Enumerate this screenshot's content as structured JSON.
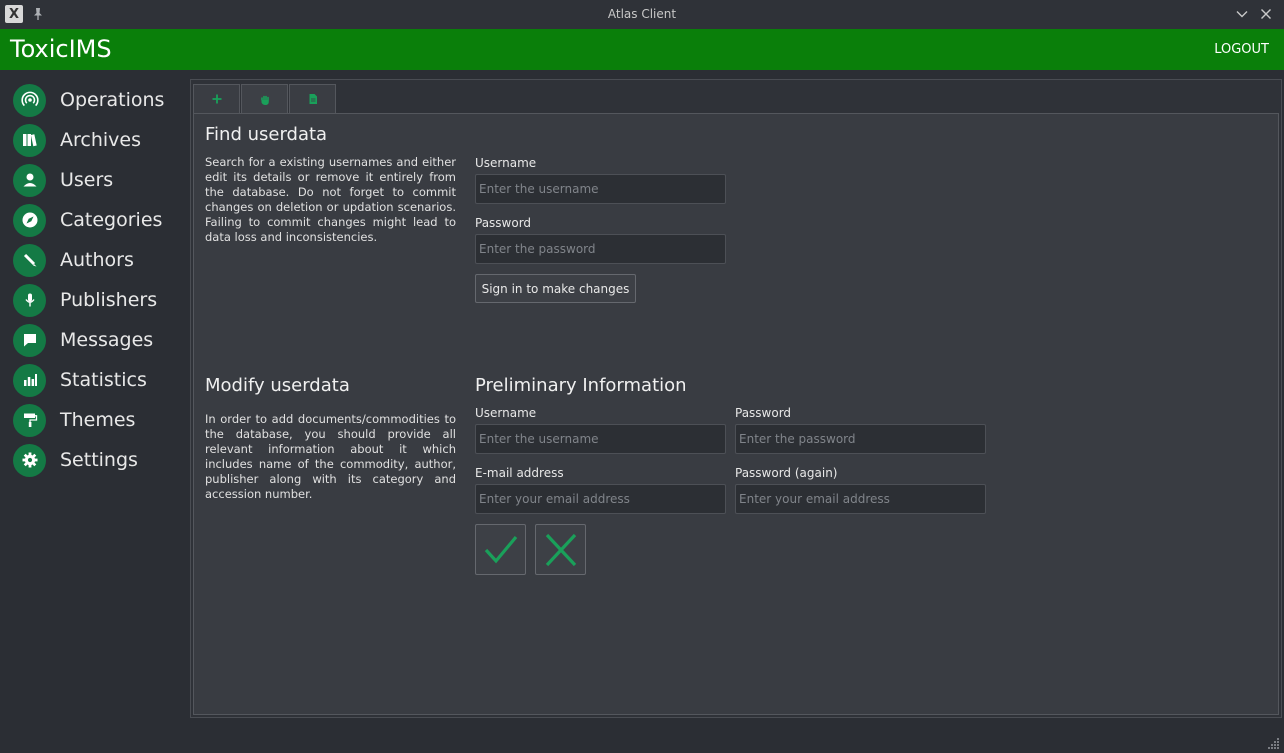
{
  "window": {
    "title": "Atlas Client",
    "app_icon_glyph": "X"
  },
  "header": {
    "brand": "ToxicIMS",
    "logout_label": "LOGOUT",
    "accent_color": "#0a7f0a"
  },
  "sidebar": {
    "items": [
      {
        "label": "Operations",
        "icon": "broadcast-icon"
      },
      {
        "label": "Archives",
        "icon": "books-icon"
      },
      {
        "label": "Users",
        "icon": "user-icon"
      },
      {
        "label": "Categories",
        "icon": "compass-icon"
      },
      {
        "label": "Authors",
        "icon": "pencil-icon"
      },
      {
        "label": "Publishers",
        "icon": "microphone-icon"
      },
      {
        "label": "Messages",
        "icon": "chat-icon"
      },
      {
        "label": "Statistics",
        "icon": "bar-chart-icon"
      },
      {
        "label": "Themes",
        "icon": "paint-roller-icon"
      },
      {
        "label": "Settings",
        "icon": "gear-icon"
      }
    ],
    "icon_bg_color": "#147a45"
  },
  "tabs": [
    {
      "icon": "plus-icon",
      "active": false
    },
    {
      "icon": "hand-icon",
      "active": true
    },
    {
      "icon": "document-icon",
      "active": false
    }
  ],
  "find": {
    "title": "Find userdata",
    "description": "Search for a existing usernames and either edit its details or remove it entirely from the database. Do not forget to commit changes on deletion or updation scenarios. Failing to commit changes might lead to data loss and inconsistencies.",
    "username_label": "Username",
    "username_placeholder": "Enter the username",
    "password_label": "Password",
    "password_placeholder": "Enter the password",
    "signin_label": "Sign in to make changes"
  },
  "modify": {
    "title": "Modify userdata",
    "description": "In order to add documents/commodities to the database, you should provide all relevant information about it which includes name of the commodity, author, publisher along with its category and accession number.",
    "prelim_title": "Preliminary Information",
    "username_label": "Username",
    "username_placeholder": "Enter the username",
    "password_label": "Password",
    "password_placeholder": "Enter the password",
    "email_label": "E-mail address",
    "email_placeholder": "Enter your email address",
    "password_again_label": "Password (again)",
    "password_again_placeholder": "Enter your email address",
    "confirm_icon": "checkmark-icon",
    "cancel_icon": "cross-icon"
  }
}
